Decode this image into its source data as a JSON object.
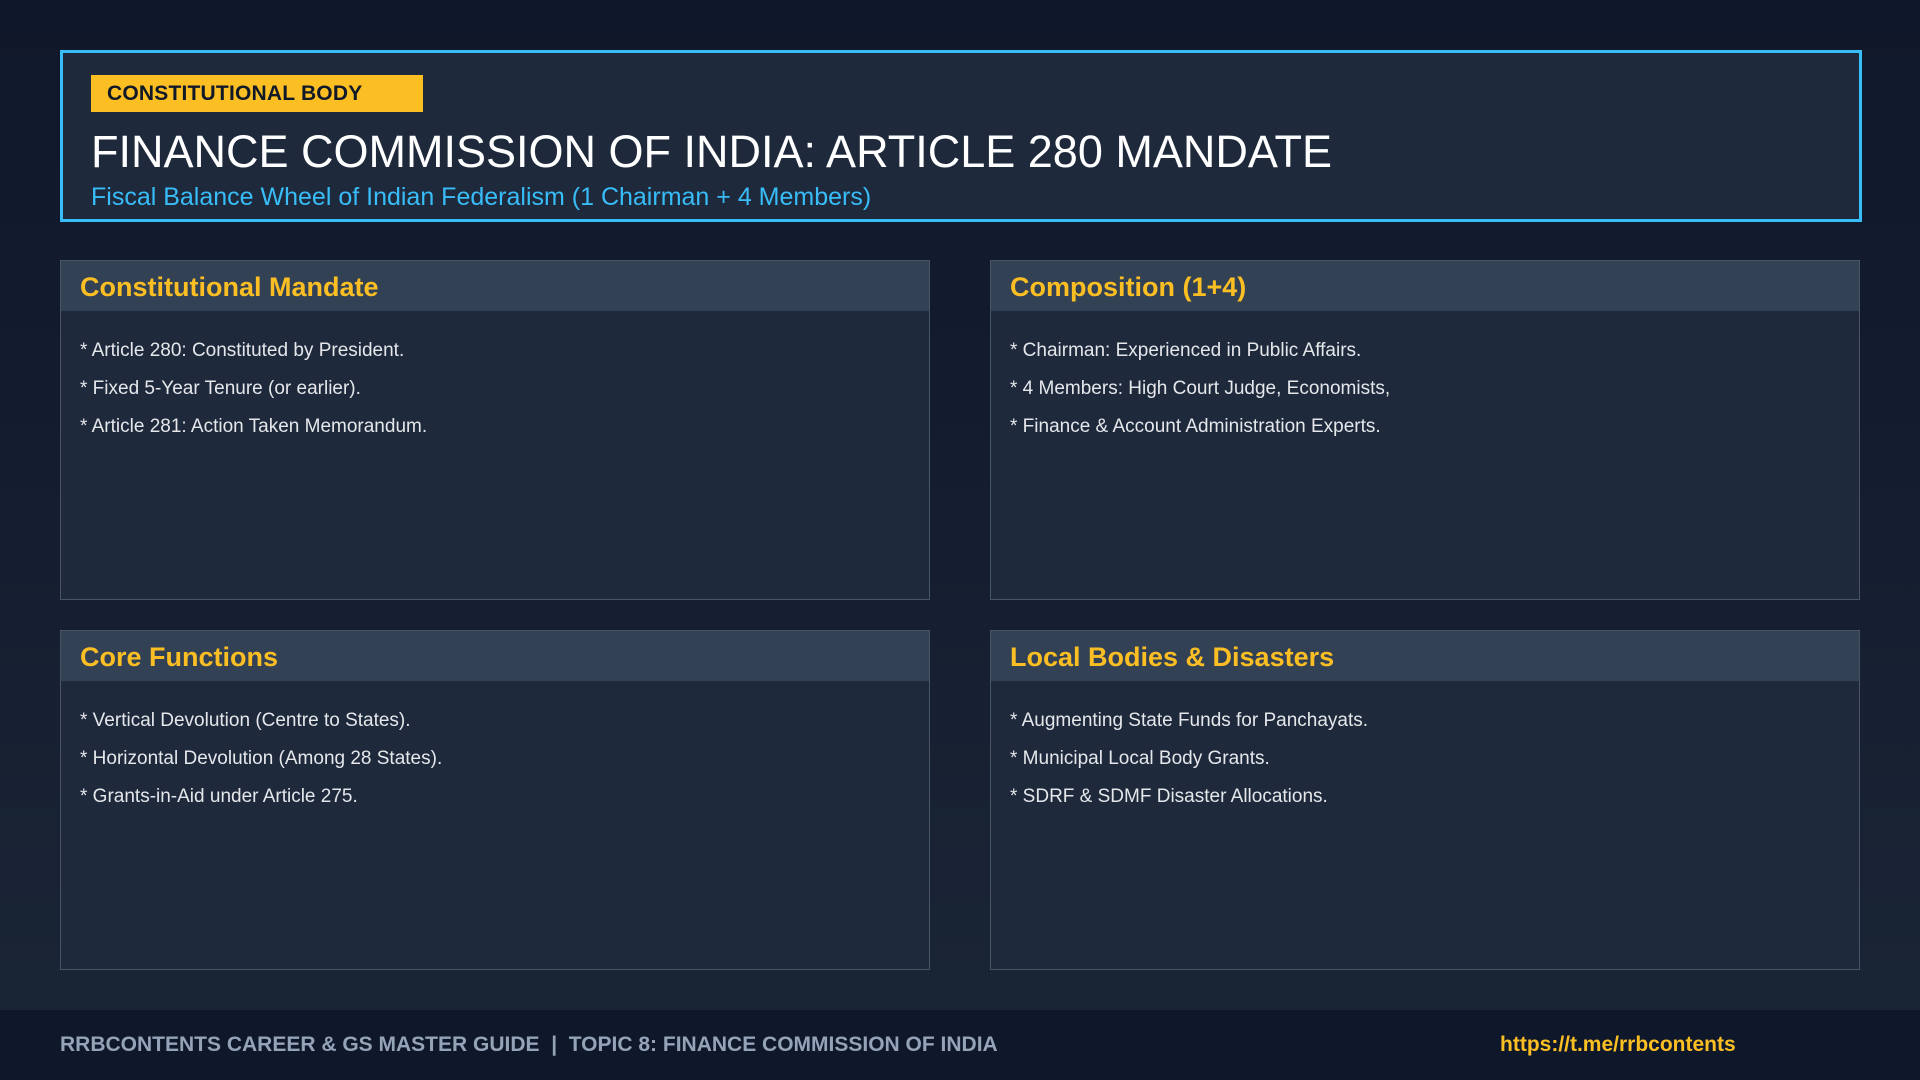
{
  "header": {
    "badge": "CONSTITUTIONAL BODY",
    "title": "FINANCE COMMISSION OF INDIA: ARTICLE 280 MANDATE",
    "subtitle": "Fiscal Balance Wheel of Indian Federalism (1 Chairman + 4 Members)"
  },
  "cards": [
    {
      "title": "Constitutional Mandate",
      "items": [
        "* Article 280: Constituted by President.",
        "* Fixed 5-Year Tenure (or earlier).",
        "* Article 281: Action Taken Memorandum."
      ]
    },
    {
      "title": "Composition (1+4)",
      "items": [
        "* Chairman: Experienced in Public Affairs.",
        "* 4 Members: High Court Judge, Economists,",
        "* Finance & Account Administration Experts."
      ]
    },
    {
      "title": "Core Functions",
      "items": [
        "* Vertical Devolution (Centre to States).",
        "* Horizontal Devolution (Among 28 States).",
        "* Grants-in-Aid under Article 275."
      ]
    },
    {
      "title": "Local Bodies & Disasters",
      "items": [
        "* Augmenting State Funds for Panchayats.",
        "* Municipal Local Body Grants.",
        "* SDRF & SDMF Disaster Allocations."
      ]
    }
  ],
  "footer": {
    "guide": "RRBCONTENTS CAREER & GS MASTER GUIDE  |  TOPIC 8: FINANCE COMMISSION OF INDIA",
    "link": "https://t.me/rrbcontents"
  },
  "colors": {
    "accent": "#fbbf24",
    "highlight": "#38bdf8",
    "background": "#0f172a",
    "card": "#1e293b"
  }
}
